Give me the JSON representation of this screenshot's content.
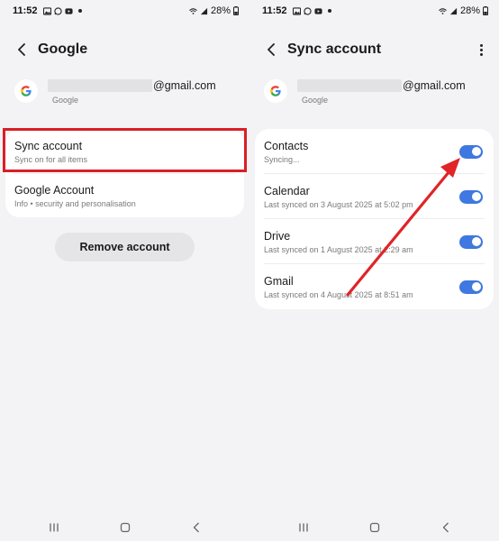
{
  "left_screen": {
    "status": {
      "time": "11:52",
      "battery": "28%"
    },
    "header": {
      "title": "Google"
    },
    "account": {
      "email_suffix": "@gmail.com",
      "provider": "Google"
    },
    "settings": [
      {
        "title": "Sync account",
        "subtitle": "Sync on for all items"
      },
      {
        "title": "Google Account",
        "subtitle": "Info • security and personalisation"
      }
    ],
    "remove_button": "Remove account"
  },
  "right_screen": {
    "status": {
      "time": "11:52",
      "battery": "28%"
    },
    "header": {
      "title": "Sync account"
    },
    "account": {
      "email_suffix": "@gmail.com",
      "provider": "Google"
    },
    "sync_items": [
      {
        "title": "Contacts",
        "subtitle": "Syncing...",
        "enabled": true
      },
      {
        "title": "Calendar",
        "subtitle": "Last synced on 3 August 2025 at 5:02 pm",
        "enabled": true
      },
      {
        "title": "Drive",
        "subtitle": "Last synced on 1 August 2025 at 2:29 am",
        "enabled": true
      },
      {
        "title": "Gmail",
        "subtitle": "Last synced on 4 August 2025 at 8:51 am",
        "enabled": true
      }
    ]
  },
  "icons": {
    "status": [
      "gallery-icon",
      "whatsapp-icon",
      "youtube-icon",
      "wifi-icon",
      "signal-icon",
      "battery-icon"
    ],
    "navigation": [
      "recent-apps-icon",
      "home-icon",
      "back-nav-icon"
    ]
  },
  "colors": {
    "toggle_on": "#3e78e0",
    "highlight": "#d91f26",
    "annotation_arrow": "#e02428",
    "background": "#f3f3f5"
  }
}
